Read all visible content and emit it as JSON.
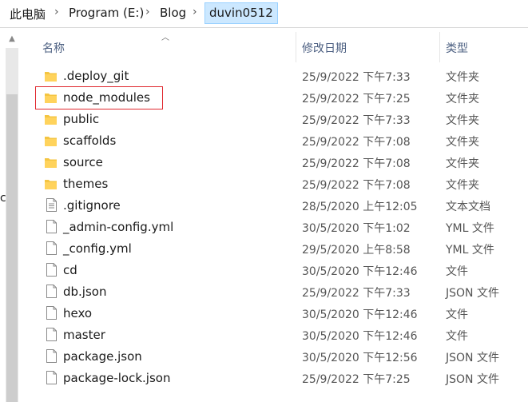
{
  "breadcrumb": {
    "items": [
      "此电脑",
      "Program (E:)",
      "Blog"
    ],
    "current": "duvin0512"
  },
  "left_pane": {
    "cut_text": "c"
  },
  "columns": {
    "name": "名称",
    "date": "修改日期",
    "type": "类型"
  },
  "files": [
    {
      "name": ".deploy_git",
      "date": "25/9/2022 下午7:33",
      "type": "文件夹",
      "kind": "folder"
    },
    {
      "name": "node_modules",
      "date": "25/9/2022 下午7:25",
      "type": "文件夹",
      "kind": "folder",
      "highlighted": true
    },
    {
      "name": "public",
      "date": "25/9/2022 下午7:33",
      "type": "文件夹",
      "kind": "folder"
    },
    {
      "name": "scaffolds",
      "date": "25/9/2022 下午7:08",
      "type": "文件夹",
      "kind": "folder"
    },
    {
      "name": "source",
      "date": "25/9/2022 下午7:08",
      "type": "文件夹",
      "kind": "folder"
    },
    {
      "name": "themes",
      "date": "25/9/2022 下午7:08",
      "type": "文件夹",
      "kind": "folder"
    },
    {
      "name": ".gitignore",
      "date": "28/5/2020 上午12:05",
      "type": "文本文档",
      "kind": "text"
    },
    {
      "name": "_admin-config.yml",
      "date": "30/5/2020 下午1:02",
      "type": "YML 文件",
      "kind": "file"
    },
    {
      "name": "_config.yml",
      "date": "29/5/2020 上午8:58",
      "type": "YML 文件",
      "kind": "file"
    },
    {
      "name": "cd",
      "date": "30/5/2020 下午12:46",
      "type": "文件",
      "kind": "file"
    },
    {
      "name": "db.json",
      "date": "25/9/2022 下午7:33",
      "type": "JSON 文件",
      "kind": "file"
    },
    {
      "name": "hexo",
      "date": "30/5/2020 下午12:46",
      "type": "文件",
      "kind": "file"
    },
    {
      "name": "master",
      "date": "30/5/2020 下午12:46",
      "type": "文件",
      "kind": "file"
    },
    {
      "name": "package.json",
      "date": "30/5/2020 下午12:56",
      "type": "JSON 文件",
      "kind": "file"
    },
    {
      "name": "package-lock.json",
      "date": "25/9/2022 下午7:25",
      "type": "JSON 文件",
      "kind": "file"
    }
  ],
  "colors": {
    "folder": "#f4c542",
    "highlight_border": "#e0282e",
    "current_crumb": "#cce8ff"
  }
}
